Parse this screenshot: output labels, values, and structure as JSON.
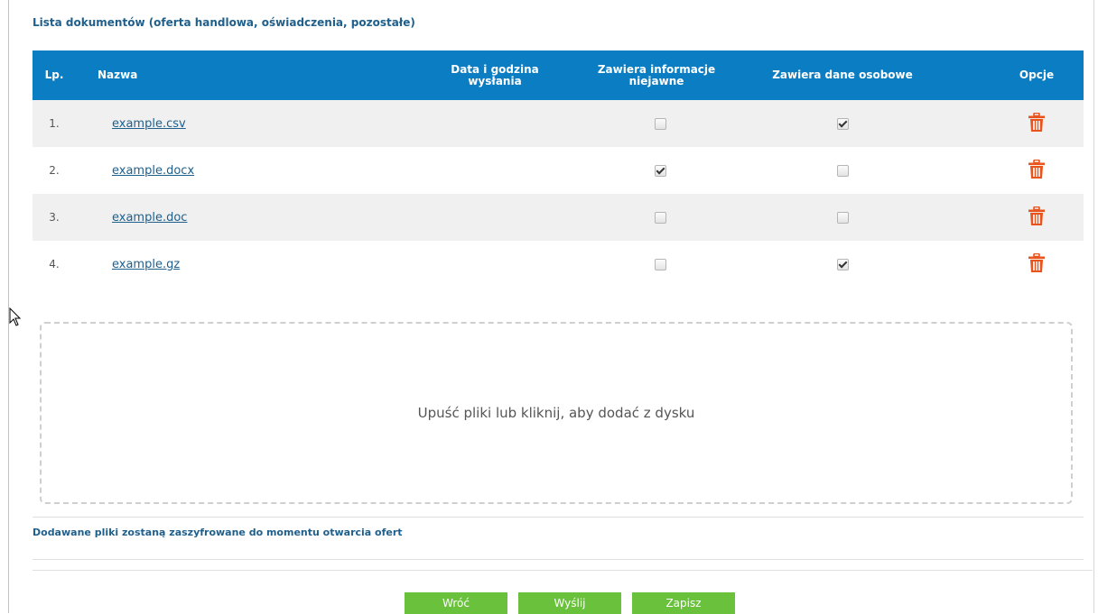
{
  "section_title": "Lista dokumentów (oferta handlowa, oświadczenia, pozostałe)",
  "table": {
    "headers": {
      "lp": "Lp.",
      "name": "Nazwa",
      "date": "Data i godzina wysłania",
      "confidential": "Zawiera informacje niejawne",
      "personal": "Zawiera dane osobowe",
      "options": "Opcje"
    },
    "rows": [
      {
        "lp": "1.",
        "name": "example.csv",
        "confidential": false,
        "personal": true
      },
      {
        "lp": "2.",
        "name": "example.docx",
        "confidential": true,
        "personal": false
      },
      {
        "lp": "3.",
        "name": "example.doc",
        "confidential": false,
        "personal": false
      },
      {
        "lp": "4.",
        "name": "example.gz",
        "confidential": false,
        "personal": true
      }
    ]
  },
  "dropzone_text": "Upuść pliki lub kliknij, aby dodać z dysku",
  "note": "Dodawane pliki zostaną zaszyfrowane do momentu otwarcia ofert",
  "buttons": {
    "back": "Wróć",
    "send": "Wyślij",
    "save": "Zapisz"
  },
  "colors": {
    "header_bg": "#0b7dc3",
    "button_bg": "#6ac23c",
    "trash": "#e8541c",
    "link": "#1f5f8b"
  },
  "icons": {
    "delete": "trash-icon",
    "cursor": "mouse-pointer-icon"
  }
}
